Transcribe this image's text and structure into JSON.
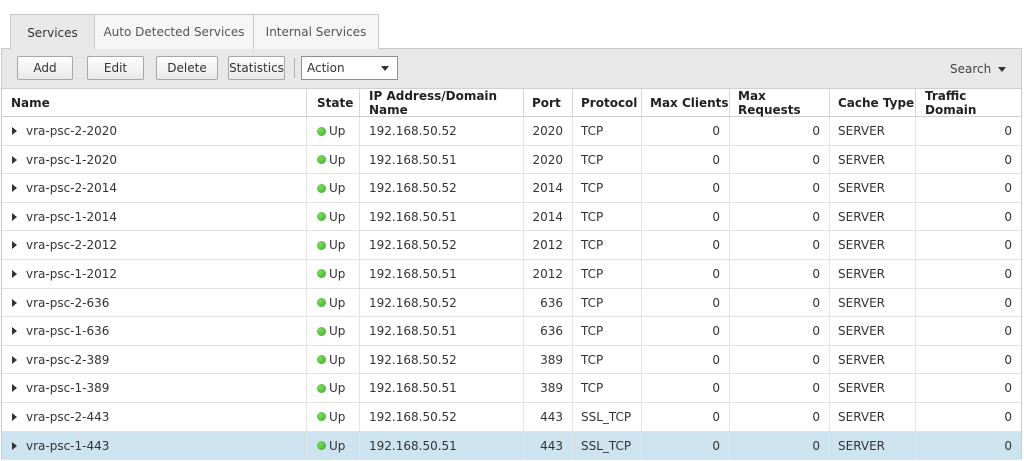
{
  "tabs": [
    {
      "label": "Services"
    },
    {
      "label": "Auto Detected Services"
    },
    {
      "label": "Internal Services"
    }
  ],
  "toolbar": {
    "add_label": "Add",
    "edit_label": "Edit",
    "delete_label": "Delete",
    "statistics_label": "Statistics",
    "action_select": "Action",
    "search_label": "Search"
  },
  "table": {
    "columns": [
      "Name",
      "State",
      "IP Address/Domain Name",
      "Port",
      "Protocol",
      "Max Clients",
      "Max Requests",
      "Cache Type",
      "Traffic Domain"
    ],
    "rows": [
      {
        "name": "vra-psc-2-2020",
        "state": "Up",
        "ip": "192.168.50.52",
        "port": "2020",
        "protocol": "TCP",
        "max_clients": "0",
        "max_requests": "0",
        "cache_type": "SERVER",
        "traffic_domain": "0"
      },
      {
        "name": "vra-psc-1-2020",
        "state": "Up",
        "ip": "192.168.50.51",
        "port": "2020",
        "protocol": "TCP",
        "max_clients": "0",
        "max_requests": "0",
        "cache_type": "SERVER",
        "traffic_domain": "0"
      },
      {
        "name": "vra-psc-2-2014",
        "state": "Up",
        "ip": "192.168.50.52",
        "port": "2014",
        "protocol": "TCP",
        "max_clients": "0",
        "max_requests": "0",
        "cache_type": "SERVER",
        "traffic_domain": "0"
      },
      {
        "name": "vra-psc-1-2014",
        "state": "Up",
        "ip": "192.168.50.51",
        "port": "2014",
        "protocol": "TCP",
        "max_clients": "0",
        "max_requests": "0",
        "cache_type": "SERVER",
        "traffic_domain": "0"
      },
      {
        "name": "vra-psc-2-2012",
        "state": "Up",
        "ip": "192.168.50.52",
        "port": "2012",
        "protocol": "TCP",
        "max_clients": "0",
        "max_requests": "0",
        "cache_type": "SERVER",
        "traffic_domain": "0"
      },
      {
        "name": "vra-psc-1-2012",
        "state": "Up",
        "ip": "192.168.50.51",
        "port": "2012",
        "protocol": "TCP",
        "max_clients": "0",
        "max_requests": "0",
        "cache_type": "SERVER",
        "traffic_domain": "0"
      },
      {
        "name": "vra-psc-2-636",
        "state": "Up",
        "ip": "192.168.50.52",
        "port": "636",
        "protocol": "TCP",
        "max_clients": "0",
        "max_requests": "0",
        "cache_type": "SERVER",
        "traffic_domain": "0"
      },
      {
        "name": "vra-psc-1-636",
        "state": "Up",
        "ip": "192.168.50.51",
        "port": "636",
        "protocol": "TCP",
        "max_clients": "0",
        "max_requests": "0",
        "cache_type": "SERVER",
        "traffic_domain": "0"
      },
      {
        "name": "vra-psc-2-389",
        "state": "Up",
        "ip": "192.168.50.52",
        "port": "389",
        "protocol": "TCP",
        "max_clients": "0",
        "max_requests": "0",
        "cache_type": "SERVER",
        "traffic_domain": "0"
      },
      {
        "name": "vra-psc-1-389",
        "state": "Up",
        "ip": "192.168.50.51",
        "port": "389",
        "protocol": "TCP",
        "max_clients": "0",
        "max_requests": "0",
        "cache_type": "SERVER",
        "traffic_domain": "0"
      },
      {
        "name": "vra-psc-2-443",
        "state": "Up",
        "ip": "192.168.50.52",
        "port": "443",
        "protocol": "SSL_TCP",
        "max_clients": "0",
        "max_requests": "0",
        "cache_type": "SERVER",
        "traffic_domain": "0"
      },
      {
        "name": "vra-psc-1-443",
        "state": "Up",
        "ip": "192.168.50.51",
        "port": "443",
        "protocol": "SSL_TCP",
        "max_clients": "0",
        "max_requests": "0",
        "cache_type": "SERVER",
        "traffic_domain": "0",
        "selected": true
      }
    ]
  },
  "icons": {
    "row_expander": "chevron-right-icon",
    "state_indicator": "status-up-icon",
    "dropdown": "chevron-down-icon"
  },
  "colors": {
    "status_up": "#3aa82a",
    "selected_row": "#cde3ef"
  }
}
